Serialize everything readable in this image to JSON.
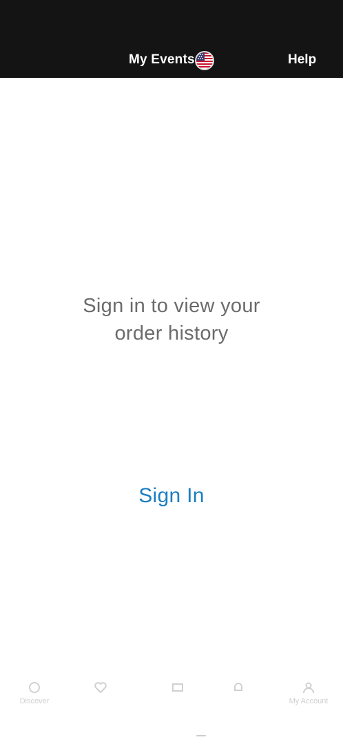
{
  "header": {
    "title": "My Events",
    "region_icon": "us-flag-icon",
    "help_label": "Help",
    "background_color": "#141414"
  },
  "main": {
    "message_line1": "Sign in to view your",
    "message_line2": "order history",
    "signin_label": "Sign In",
    "link_color": "#1b7ec2"
  },
  "bottom_nav": {
    "discover_label": "Discover",
    "account_label": "My Account"
  }
}
